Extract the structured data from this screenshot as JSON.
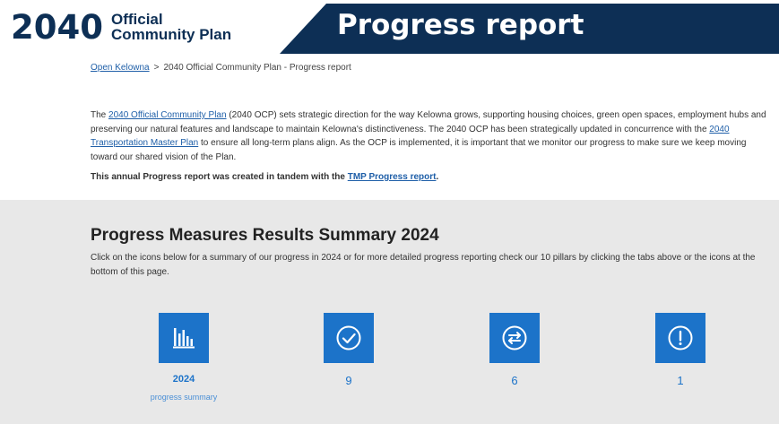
{
  "header": {
    "logo_year": "2040",
    "logo_line1": "Official",
    "logo_line2": "Community Plan",
    "banner_title": "Progress report"
  },
  "breadcrumb": {
    "home_link": "Open Kelowna",
    "separator": ">",
    "current": "2040 Official Community Plan - Progress report"
  },
  "intro": {
    "p1_pre": "The ",
    "p1_link1": "2040 Official Community Plan",
    "p1_mid1": " (2040 OCP) sets strategic direction for the way Kelowna grows, supporting housing choices, green open spaces, employment hubs and preserving our natural features and landscape to maintain Kelowna's distinctiveness. The 2040 OCP has been strategically updated in concurrence with the ",
    "p1_link2": "2040 Transportation Master Plan",
    "p1_post": " to ensure all long-term plans align. As the OCP is implemented, it is important that we monitor our progress to make sure we keep moving toward our shared vision of the Plan.",
    "p2_pre": "This annual Progress report was created in tandem with the ",
    "p2_link": "TMP Progress report",
    "p2_post": "."
  },
  "summary": {
    "title": "Progress Measures Results Summary 2024",
    "description": "Click on the icons below for a summary of our progress in 2024 or for more detailed progress reporting check our 10 pillars by clicking the tabs above or the icons at the bottom of this page.",
    "tiles": [
      {
        "icon": "bar-chart-icon",
        "label": "2024",
        "sublabel": "progress summary"
      },
      {
        "icon": "check-circle-icon",
        "label": "9"
      },
      {
        "icon": "exchange-circle-icon",
        "label": "6"
      },
      {
        "icon": "alert-circle-icon",
        "label": "1"
      }
    ]
  },
  "colors": {
    "navy": "#0d2f55",
    "tile_blue": "#1c73c9",
    "link_blue": "#1f5fa8",
    "section_gray": "#e8e8e8"
  }
}
